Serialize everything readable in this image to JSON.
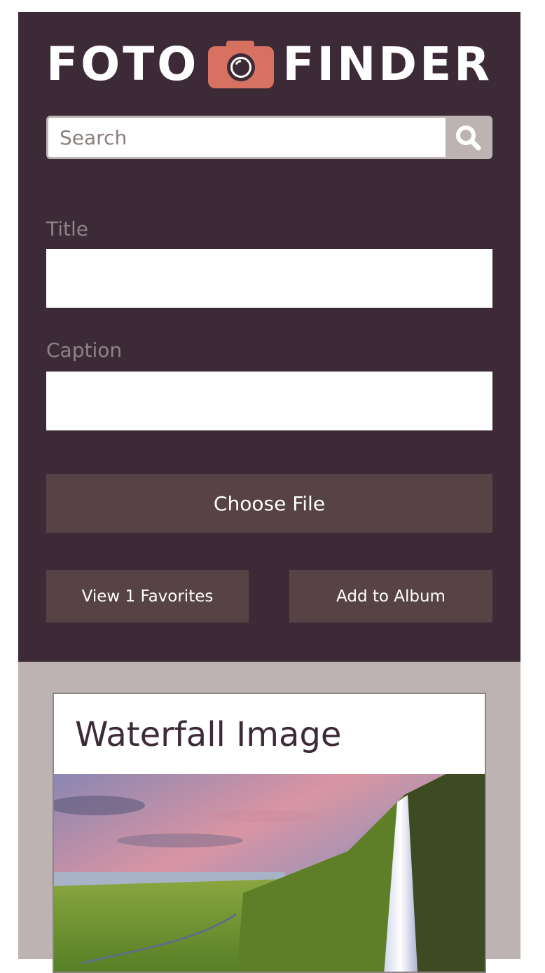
{
  "header": {
    "logo_left": "FOTO",
    "logo_right": "FINDER",
    "logo_icon": "camera-icon"
  },
  "search": {
    "placeholder": "Search",
    "value": "",
    "icon": "search-icon"
  },
  "form": {
    "title_label": "Title",
    "title_value": "",
    "caption_label": "Caption",
    "caption_value": "",
    "choose_file_label": "Choose File",
    "view_favorites_label": "View 1 Favorites",
    "add_to_album_label": "Add to Album"
  },
  "cards": [
    {
      "title": "Waterfall Image"
    }
  ],
  "colors": {
    "header_bg": "#3c2b37",
    "button_bg": "#574346",
    "accent": "#d77262",
    "content_bg": "#bdb3b2"
  }
}
